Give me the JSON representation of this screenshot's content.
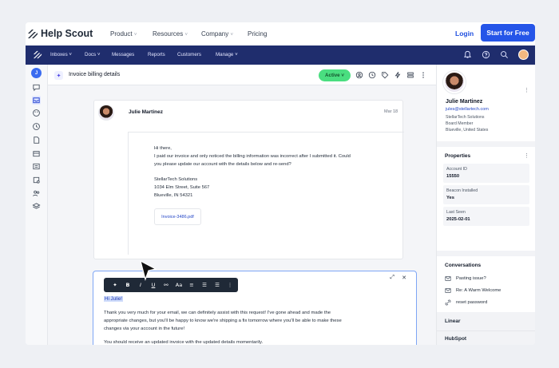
{
  "brand": {
    "name": "Help Scout"
  },
  "topnav": {
    "links": [
      "Product",
      "Resources",
      "Company",
      "Pricing"
    ],
    "chev": "˅",
    "login": "Login",
    "cta": "Start for Free"
  },
  "appbar": {
    "links": [
      "Inboxes ˅",
      "Docs ˅",
      "Messages",
      "Reports",
      "Customers",
      "Manage ˅"
    ]
  },
  "rail": {
    "user_initial": "J"
  },
  "conversation": {
    "title": "Invoice billing details",
    "status": "Active ˅",
    "message": {
      "from": "Julie Martinez",
      "date": "Mar 18",
      "lines": [
        "Hi there,",
        "I paid our invoice and only noticed the billing information was  incorrect after I submitted it. Could",
        "you please update our account with the details below and re-send?",
        "StellarTech Solutions",
        "1034 Elm Street, Suite 567",
        "Blueville, IN 54321"
      ],
      "attachment": "Invoice-3486.pdf"
    }
  },
  "reply": {
    "toolbar": [
      "✦",
      "B",
      "I",
      "U",
      "⚯",
      "Aa",
      "≡",
      "☰",
      "☰",
      "⋮"
    ],
    "greeting": "Hi Julie!",
    "lines": [
      "Thank you very much for your email, we can definitely assist with this request! I've gone ahead and made the",
      "appropriate changes, but you'll be happy to know we're shipping a fix tomorrow where you'll be able to make these",
      "changes via your account in the future!",
      "You should receive an updated invoice with the updated details momentarily."
    ],
    "close": "✕",
    "expand": "⤢"
  },
  "profile": {
    "name": "Julie Martinez",
    "email": "jules@stellartech.com",
    "company": "StellarTech Solutions",
    "role": "Board Member",
    "location": "Blueville, United States"
  },
  "properties": {
    "title": "Properties",
    "fields": [
      {
        "label": "Account ID",
        "value": "15550"
      },
      {
        "label": "Beacon Installed",
        "value": "Yes"
      },
      {
        "label": "Last Seen",
        "value": "2025-02-01"
      }
    ]
  },
  "conversations": {
    "title": "Conversations",
    "items": [
      "Pasting issue?",
      "Re: A Warm Welcome",
      "reset password"
    ]
  },
  "integrations": [
    "Linear",
    "HubSpot"
  ],
  "colors": {
    "appbar": "#1f2d6d",
    "cta": "#2555e8",
    "status_active": "#4ade80",
    "selection": "#cfdcfb"
  },
  "icons": [
    "help-scout-logo",
    "bell-icon",
    "help-icon",
    "search-icon",
    "user-avatar",
    "sparkle-icon",
    "clock-icon",
    "tag-icon",
    "bolt-icon",
    "layers-icon",
    "more-icon",
    "chat-icon",
    "inbox-icon",
    "cursor-icon"
  ]
}
